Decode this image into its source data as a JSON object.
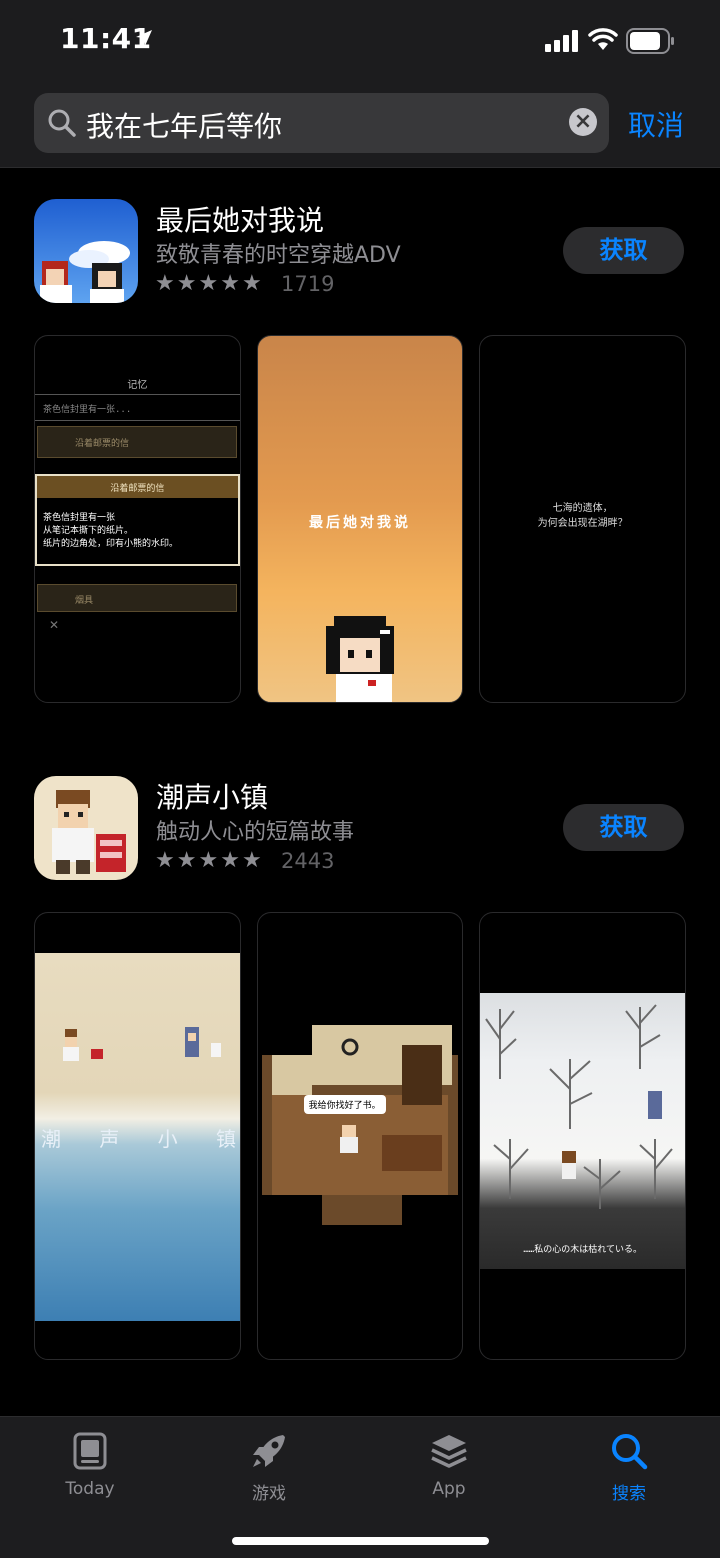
{
  "status_bar": {
    "time": "11:41"
  },
  "search": {
    "query": "我在七年后等你",
    "cancel_label": "取消"
  },
  "results": [
    {
      "name": "最后她对我说",
      "subtitle": "致敬青春的时空穿越ADV",
      "rating_stars": 5,
      "rating_count": "1719",
      "get_label": "获取",
      "screenshots": {
        "s1": {
          "header": "记忆",
          "row1": "茶色信封里有一张...",
          "row2": "沿着邮票的信",
          "popup_title": "沿着邮票的信",
          "popup_line1": "茶色信封里有一张",
          "popup_line2": "从笔记本撕下的纸片。",
          "popup_line3": "纸片的边角处，印有小熊的水印。",
          "row3": "烟具"
        },
        "s2": {
          "title": "最后她对我说"
        },
        "s3": {
          "line1": "七海的遗体，",
          "line2": "为何会出现在湖畔？"
        }
      }
    },
    {
      "name": "潮声小镇",
      "subtitle": "触动人心的短篇故事",
      "rating_stars": 5,
      "rating_count": "2443",
      "get_label": "获取",
      "screenshots": {
        "s1": {
          "title_chars": [
            "潮",
            "声",
            "小",
            "镇"
          ]
        },
        "s2": {
          "speech": "我给你找好了书。"
        },
        "s3": {
          "caption": "……私の心の木は枯れている。"
        }
      }
    }
  ],
  "tabbar": {
    "items": [
      {
        "label": "Today",
        "icon": "today-icon",
        "active": false
      },
      {
        "label": "游戏",
        "icon": "rocket-icon",
        "active": false
      },
      {
        "label": "App",
        "icon": "stack-icon",
        "active": false
      },
      {
        "label": "搜索",
        "icon": "search-icon",
        "active": true
      }
    ]
  },
  "colors": {
    "accent": "#0a84ff",
    "background": "#000000",
    "bar": "#1c1c1e"
  }
}
